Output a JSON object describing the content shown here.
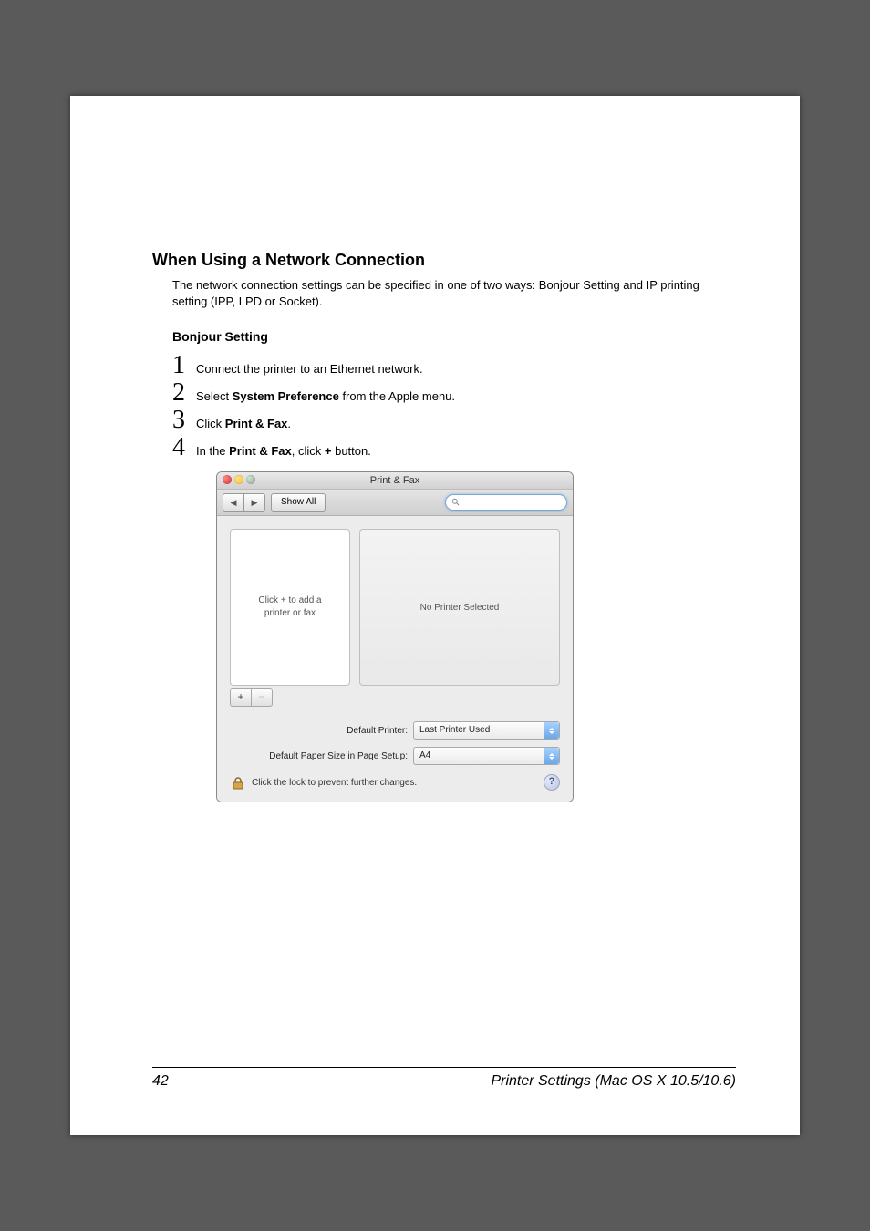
{
  "heading": "When Using a Network Connection",
  "intro": "The network connection settings can be specified in one of two ways: Bonjour Setting and IP printing setting (IPP, LPD or Socket).",
  "subheading": "Bonjour Setting",
  "steps": {
    "s1": {
      "num": "1",
      "text": "Connect the printer to an Ethernet network."
    },
    "s2": {
      "num": "2",
      "pre": "Select ",
      "bold": "System Preference",
      "post": " from the Apple menu."
    },
    "s3": {
      "num": "3",
      "pre": "Click ",
      "bold": "Print & Fax",
      "post": "."
    },
    "s4": {
      "num": "4",
      "pre": "In the ",
      "bold1": "Print & Fax",
      "mid": ", click ",
      "bold2": "+",
      "post": " button."
    }
  },
  "dialog": {
    "title": "Print & Fax",
    "show_all": "Show All",
    "placeholder_msg": "Click + to add a\nprinter or fax",
    "right_msg": "No Printer Selected",
    "add_label": "+",
    "remove_label": "−",
    "default_printer_label": "Default Printer:",
    "default_printer_value": "Last Printer Used",
    "paper_label": "Default Paper Size in Page Setup:",
    "paper_value": "A4",
    "lock_text": "Click the lock to prevent further changes.",
    "help": "?"
  },
  "footer": {
    "page": "42",
    "title": "Printer Settings (Mac OS X 10.5/10.6)"
  }
}
